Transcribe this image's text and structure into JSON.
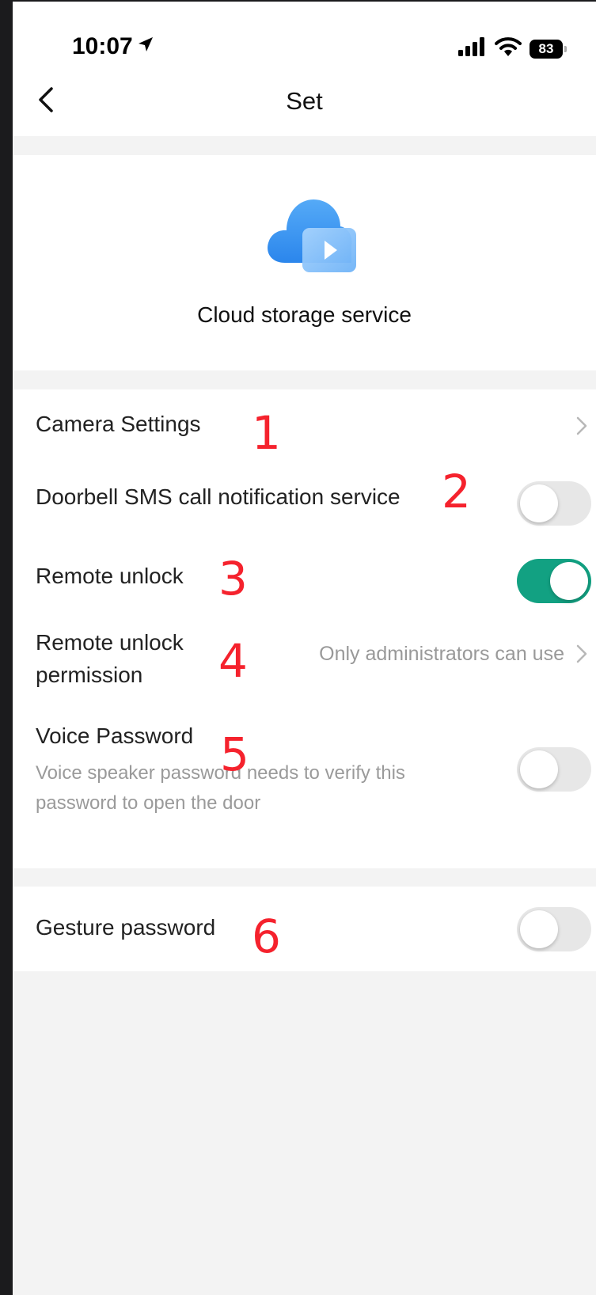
{
  "status_bar": {
    "time": "10:07",
    "battery": "83",
    "icons": [
      "location-arrow-icon",
      "cellular-signal-icon",
      "wifi-icon",
      "battery-icon"
    ]
  },
  "nav": {
    "title": "Set",
    "back_icon": "chevron-left-icon"
  },
  "cloud": {
    "label": "Cloud storage service",
    "icon": "cloud-video-icon",
    "colors": {
      "cloud": "#3d98f2",
      "screen": "#8cc4fa"
    }
  },
  "settings": {
    "camera_settings": {
      "label": "Camera Settings",
      "marker": "1"
    },
    "sms_notification": {
      "label": "Doorbell SMS call notification service",
      "enabled": false,
      "marker": "2"
    },
    "remote_unlock": {
      "label": "Remote unlock",
      "enabled": true,
      "marker": "3"
    },
    "remote_unlock_permission": {
      "label_line1": "Remote unlock",
      "label_line2": "permission",
      "value": "Only administrators can use",
      "marker": "4"
    },
    "voice_password": {
      "label": "Voice Password",
      "description_line1": "Voice speaker password needs to verify this",
      "description_line2": "password to open the door",
      "enabled": false,
      "marker": "5"
    },
    "gesture_password": {
      "label": "Gesture password",
      "enabled": false,
      "marker": "6"
    }
  },
  "colors": {
    "accent_toggle_on": "#12a182",
    "toggle_off": "#e7e7e7",
    "marker": "#f5222d",
    "background": "#f3f3f3"
  }
}
